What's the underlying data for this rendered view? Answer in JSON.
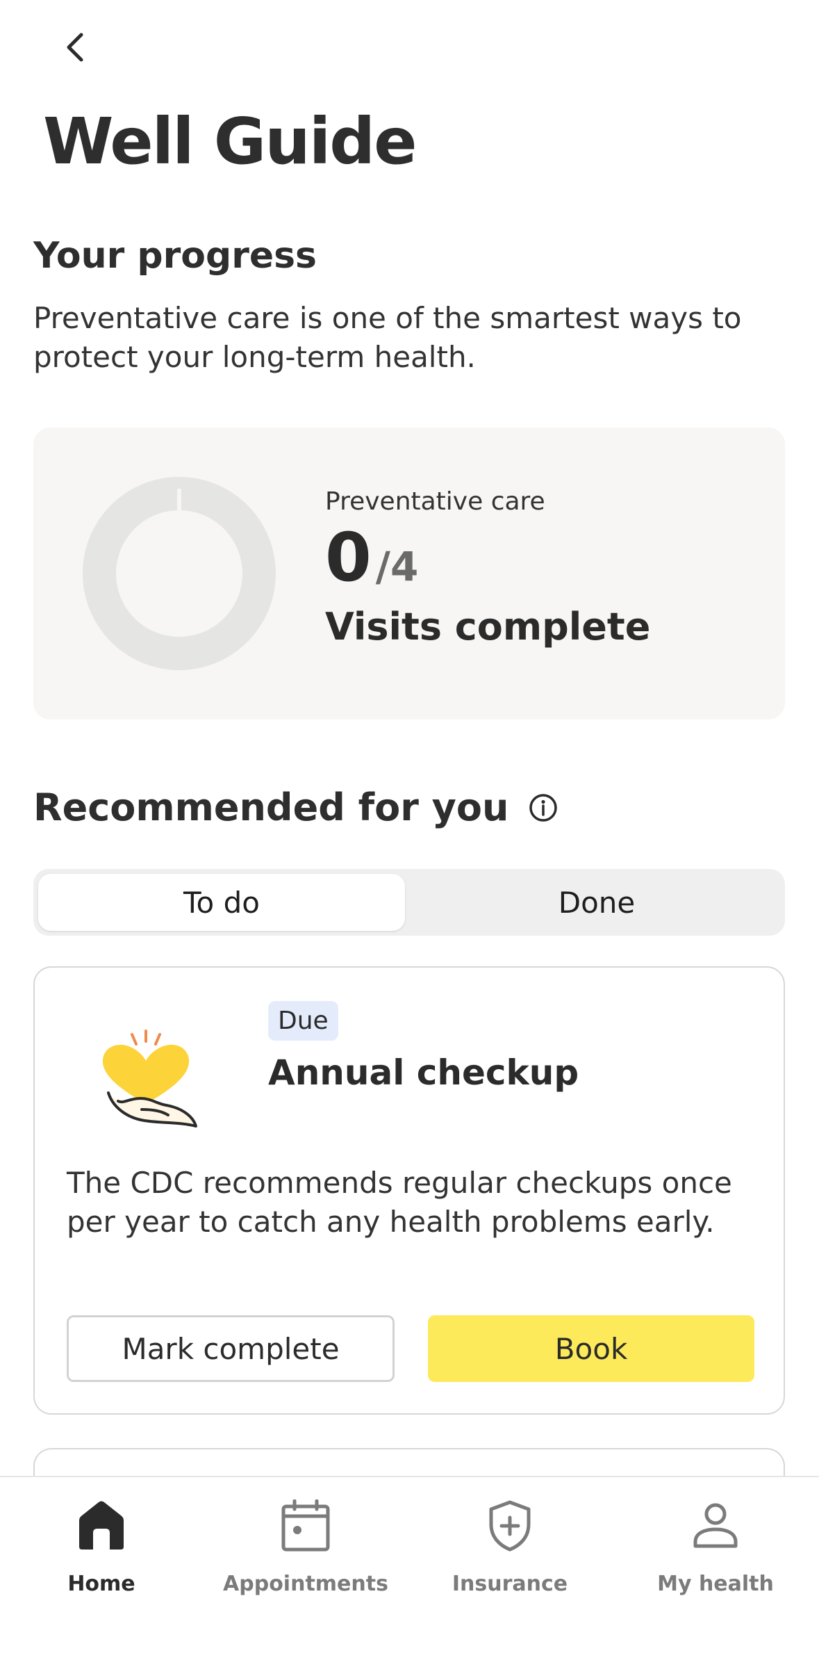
{
  "header": {
    "back_icon": "chevron-left-icon",
    "title": "Well Guide"
  },
  "progress": {
    "heading": "Your progress",
    "description": "Preventative care is one of the smartest ways to protect your long-term health.",
    "card": {
      "label": "Preventative care",
      "completed": "0",
      "total": "/4",
      "subtitle": "Visits complete",
      "fraction_complete": 0
    }
  },
  "recommended": {
    "heading": "Recommended for you",
    "info_icon": "info-icon",
    "tabs": [
      {
        "label": "To do",
        "selected": true
      },
      {
        "label": "Done",
        "selected": false
      }
    ],
    "card": {
      "illustration": "heart-in-hand-icon",
      "badge": "Due",
      "title": "Annual checkup",
      "description": "The CDC recommends regular checkups once per year to catch any health problems early.",
      "secondary_button": "Mark complete",
      "primary_button": "Book"
    }
  },
  "bottom_nav": {
    "items": [
      {
        "label": "Home",
        "icon": "home-icon",
        "active": true
      },
      {
        "label": "Appointments",
        "icon": "calendar-icon",
        "active": false
      },
      {
        "label": "Insurance",
        "icon": "shield-plus-icon",
        "active": false
      },
      {
        "label": "My health",
        "icon": "person-icon",
        "active": false
      }
    ]
  },
  "colors": {
    "accent_yellow": "#fdea5a",
    "badge_blue": "#e4ecfb",
    "card_bg": "#f7f6f4",
    "donut_track": "#e5e5e3"
  }
}
